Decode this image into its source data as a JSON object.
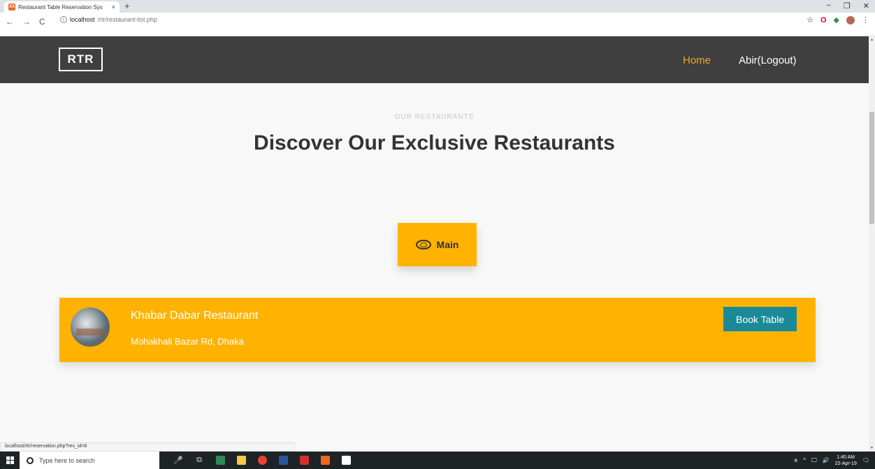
{
  "browser": {
    "tab_title": "Restaurant Table Reservation Sys",
    "tab_close": "×",
    "new_tab": "+",
    "favicon_text": "XX",
    "url_host": "localhost",
    "url_path": "/rtr/restaurant-list.php",
    "nav_back": "←",
    "nav_forward": "→",
    "nav_reload": "C",
    "url_info": "i",
    "bookmark": "☆",
    "ext_opera": "O",
    "ext_green": "◆",
    "ext_menu": "⋮",
    "win_min": "−",
    "win_max": "❐",
    "win_close": "✕"
  },
  "header": {
    "logo": "RTR",
    "nav": {
      "home": "Home",
      "logout": "Abir(Logout)"
    }
  },
  "content": {
    "eyebrow": "OUR RESTAURANTS",
    "title": "Discover Our Exclusive Restaurants",
    "category_tab": "Main"
  },
  "restaurants": [
    {
      "name": "Khabar Dabar Restaurant",
      "address": "Mohakhali Bazar Rd, Dhaka",
      "action": "Book Table"
    }
  ],
  "status_bar": {
    "url": "localhost/rtr/reservation.php?res_id=8"
  },
  "scrollbar": {
    "up": "▲",
    "down": "▼"
  },
  "taskbar": {
    "search_placeholder": "Type here to search",
    "mic": "🎤",
    "task_view": "⧉",
    "tray_people": "ጸ",
    "tray_up": "^",
    "tray_network": "🖵",
    "tray_volume": "🔊",
    "time": "1:40 AM",
    "date": "22-Apr-19",
    "notifications": "🗨"
  },
  "colors": {
    "accent": "#ffb300",
    "header_bg": "#3f3f40",
    "home_link": "#f5a623",
    "book_button": "#1a8a98"
  }
}
